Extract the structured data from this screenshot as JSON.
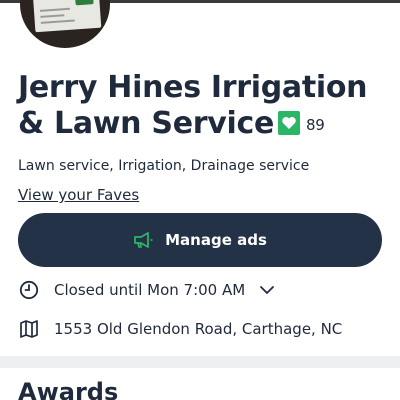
{
  "business": {
    "name": "Jerry Hines Irrigation & Lawn Service",
    "badge_icon": "verified-heart-icon",
    "badge_color": "#2bb566",
    "review_count": "89",
    "categories": "Lawn service, Irrigation, Drainage service",
    "faves_link": "View your Faves"
  },
  "actions": {
    "manage_ads_label": "Manage ads",
    "manage_ads_icon": "megaphone-icon",
    "button_color": "#243248"
  },
  "info": {
    "hours_icon": "clock-icon",
    "hours_text": "Closed until Mon 7:00 AM",
    "address_icon": "map-icon",
    "address_text": "1553 Old Glendon Road, Carthage, NC"
  },
  "sections": {
    "awards_title": "Awards"
  }
}
